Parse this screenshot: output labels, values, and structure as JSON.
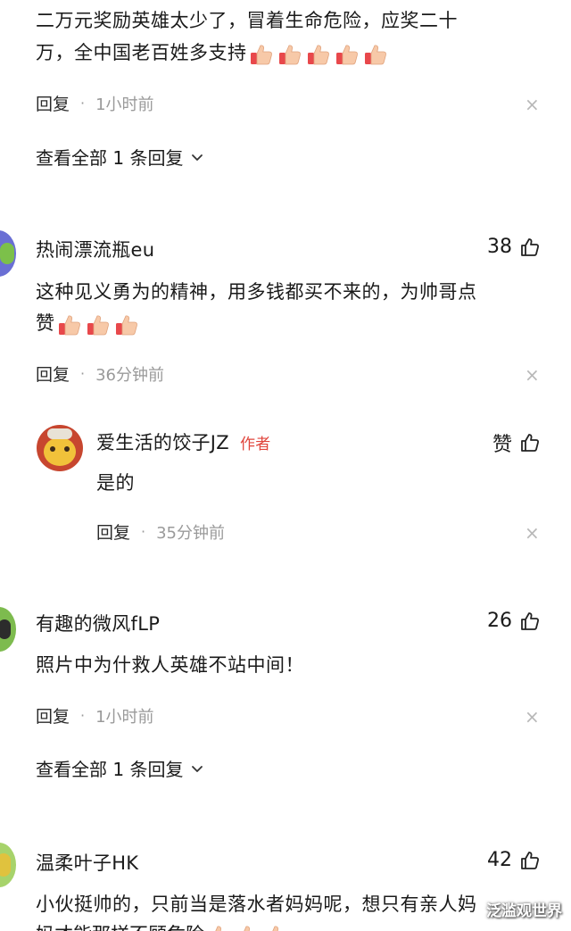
{
  "comment0": {
    "text_line1": "二万元奖励英雄太少了，冒着生命危险，应奖二十",
    "text_line2": "万，全中国老百姓多支持",
    "reply_label": "回复",
    "time": "1小时前",
    "see_all": "查看全部 1 条回复"
  },
  "comment1": {
    "username": "热闹漂流瓶eu",
    "likes": "38",
    "text_line1": "这种见义勇为的精神，用多钱都买不来的，为帅哥点",
    "text_line2": "赞",
    "reply_label": "回复",
    "time": "36分钟前"
  },
  "reply1": {
    "username": "爱生活的饺子JZ",
    "badge": "作者",
    "likes": "赞",
    "text": "是的",
    "reply_label": "回复",
    "time": "35分钟前"
  },
  "comment2": {
    "username": "有趣的微风fLP",
    "likes": "26",
    "text": "照片中为什救人英雄不站中间！",
    "reply_label": "回复",
    "time": "1小时前",
    "see_all": "查看全部 1 条回复"
  },
  "comment3": {
    "username": "温柔叶子HK",
    "likes": "42",
    "text_line1": "小伙挺帅的，只前当是落水者妈妈呢，想只有亲人妈",
    "text_line2": "妈才能那样不顾危险"
  },
  "watermark": "泛滥观世界",
  "colors": {
    "text": "#1a1a1a",
    "muted": "#9a9a9a",
    "author_badge": "#e0453c",
    "thumb_skin": "#f7c9a8",
    "thumb_cuff": "#e8484b"
  },
  "icons": {
    "like": "thumbs-up-outline-icon",
    "emoji": "thumbs-up-emoji-icon",
    "close": "close-icon",
    "chevron": "chevron-down-icon"
  }
}
